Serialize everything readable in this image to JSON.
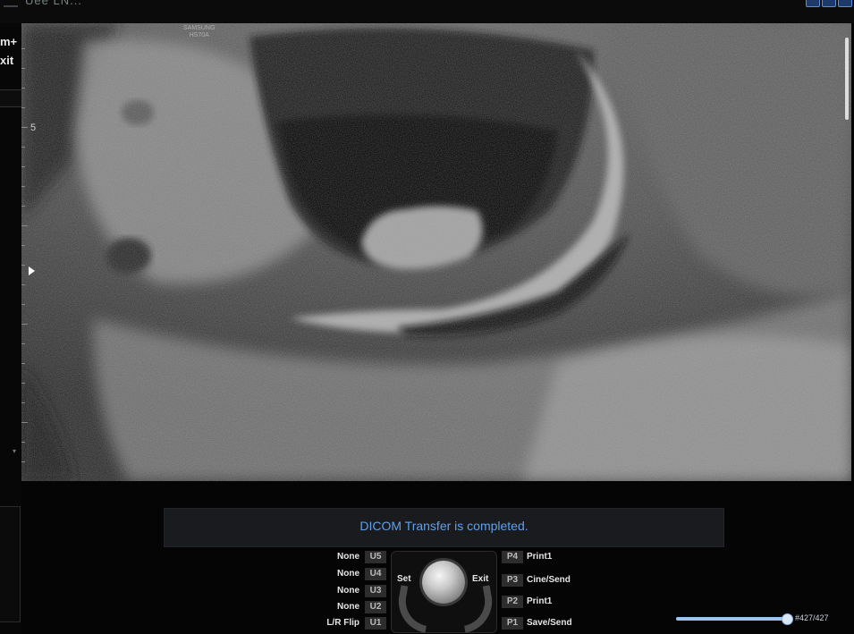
{
  "window": {
    "title": "Uee LN..."
  },
  "left_panel": {
    "label_top": "m+",
    "label_exit": "xit"
  },
  "ultrasound": {
    "brand_line1": "SAMSUNG",
    "brand_line2": "HS70A",
    "depth_label": "5"
  },
  "status": {
    "message": "DICOM Transfer is completed."
  },
  "user_keys": [
    {
      "label": "None",
      "key": "U5"
    },
    {
      "label": "None",
      "key": "U4"
    },
    {
      "label": "None",
      "key": "U3"
    },
    {
      "label": "None",
      "key": "U2"
    },
    {
      "label": "L/R Flip",
      "key": "U1"
    }
  ],
  "trackball": {
    "set_label": "Set",
    "exit_label": "Exit"
  },
  "print_keys": [
    {
      "key": "P4",
      "label": "Print1"
    },
    {
      "key": "P3",
      "label": "Cine/Send"
    },
    {
      "key": "P2",
      "label": "Print1"
    },
    {
      "key": "P1",
      "label": "Save/Send"
    }
  ],
  "cine": {
    "counter": "#427/427",
    "progress": 1.0
  },
  "colors": {
    "status_text": "#5fa0ea",
    "accent": "#5b8fd6",
    "cine_track": "#2f4f78"
  }
}
